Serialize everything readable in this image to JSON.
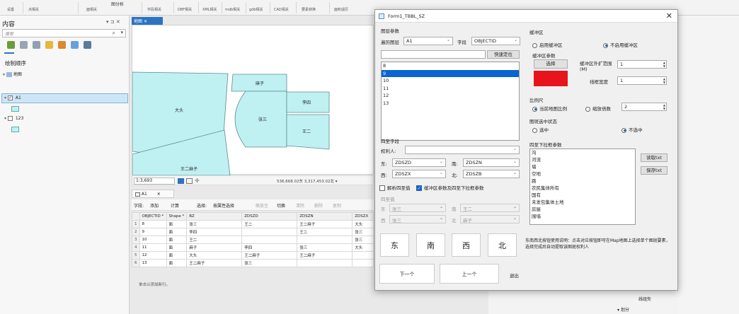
{
  "ribbon": {
    "top_group": "图分析",
    "groups": [
      "设置",
      "点相关",
      "面相关",
      "字段相关",
      "DBF相关",
      "XML相关",
      "mdb相关",
      "gdb相关",
      "CAD相关",
      "要素转换",
      "面积适历"
    ]
  },
  "contents": {
    "title": "内容",
    "pin": "▾ ⊐ ✕",
    "search_placeholder": "搜索",
    "draw_order": "绘制顺序",
    "map_name": "地图",
    "layers": [
      {
        "name": "A1",
        "checked": true
      },
      {
        "name": "123",
        "checked": false
      }
    ]
  },
  "map": {
    "tab": "地图",
    "scale": "1:3,693",
    "coords": "536,668.02东 3,317,453.02北 ▾",
    "parcel_labels": [
      "大头",
      "麻子",
      "李四",
      "张三",
      "王二",
      "王二麻子"
    ]
  },
  "table": {
    "tab": "A1",
    "toolbar": [
      "字段:",
      "添加",
      "计算",
      "选择:",
      "按属性选择",
      "缩放至",
      "切换",
      "清除",
      "删除",
      "复制"
    ],
    "columns": [
      "OBJECTID *",
      "Shape *",
      "BZ",
      "ZDSZD",
      "ZDSZN",
      "ZDSZX"
    ],
    "rows": [
      [
        "1",
        "8",
        "面",
        "张三",
        "王二",
        "王二麻子",
        "大头"
      ],
      [
        "2",
        "9",
        "面",
        "李四",
        "",
        "王二",
        "张三"
      ],
      [
        "3",
        "10",
        "面",
        "王二",
        "",
        "",
        "张三"
      ],
      [
        "4",
        "11",
        "面",
        "麻子",
        "李四",
        "张三",
        "大头"
      ],
      [
        "5",
        "12",
        "面",
        "大头",
        "王二麻子",
        "王二麻子",
        ""
      ],
      [
        "6",
        "13",
        "面",
        "王二麻子",
        "张三",
        "",
        ""
      ]
    ],
    "add_row": "单击以添加新行。"
  },
  "right_strip": {
    "item1": "线组矢",
    "item2": "▾ 划分"
  },
  "dialog": {
    "title": "Form1_TBBL_SZ",
    "close": "✕",
    "layer_params": "图层参数",
    "traverse_layer_label": "遍历图层",
    "traverse_layer_value": "A1",
    "field_label": "字段",
    "field_value": "OBJECTID",
    "quick_locate": "快速定位",
    "ids": [
      "8",
      "9",
      "10",
      "11",
      "12",
      "13"
    ],
    "selected_id": "9",
    "boundary_fields": "四至字段",
    "owner_label": "权利人:",
    "east_label": "东:",
    "east_value": "ZDSZD",
    "south_label": "南:",
    "south_value": "ZDSZN",
    "west_label": "西:",
    "west_value": "ZDSZX",
    "north_label": "北:",
    "north_value": "ZDSZB",
    "chk_parse": "解析四至值",
    "chk_buffer": "缓冲区参数及四至下拉框参数",
    "boundary_value": "四至值",
    "dis_east_label": "东",
    "dis_east": "张三",
    "dis_south_label": "南",
    "dis_south": "王二",
    "dis_west_label": "西",
    "dis_west": "张三",
    "dis_north_label": "北",
    "dis_north": "麻子",
    "buffer": "缓冲区",
    "enable_buffer": "启用缓冲区",
    "disable_buffer": "不启用缓冲区",
    "buffer_params": "缓冲区参数",
    "choose": "选择",
    "buffer_color": "#e8141b",
    "expand_label": "缓冲区外扩范围(M)",
    "expand_value": "1",
    "line_width_label": "线框宽度",
    "line_width_value": "1",
    "scale": "比例尺",
    "current_scale": "当前地图比例",
    "zoom_factor": "缩放倍数",
    "zoom_value": "2",
    "select_state": "图斑选中状态",
    "selected": "选中",
    "not_selected": "不选中",
    "dropdown_params": "四至下拉框参数",
    "dropdown_items": [
      "沟",
      "河流",
      "墙",
      "空地",
      "路",
      "农民集体所有",
      "国有",
      "未发包集体土地",
      "房屋",
      "围墙"
    ],
    "read_txt": "读取txt",
    "save_txt": "保存txt",
    "dir_east": "东",
    "dir_south": "南",
    "dir_west": "西",
    "dir_north": "北",
    "note": "东南西北按钮使用说明：点击对应按钮即可在Map地图上选择单个图斑要素，选择完成后自动提取该图斑权利人",
    "next": "下一个",
    "prev": "上一个",
    "exit": "退出"
  }
}
